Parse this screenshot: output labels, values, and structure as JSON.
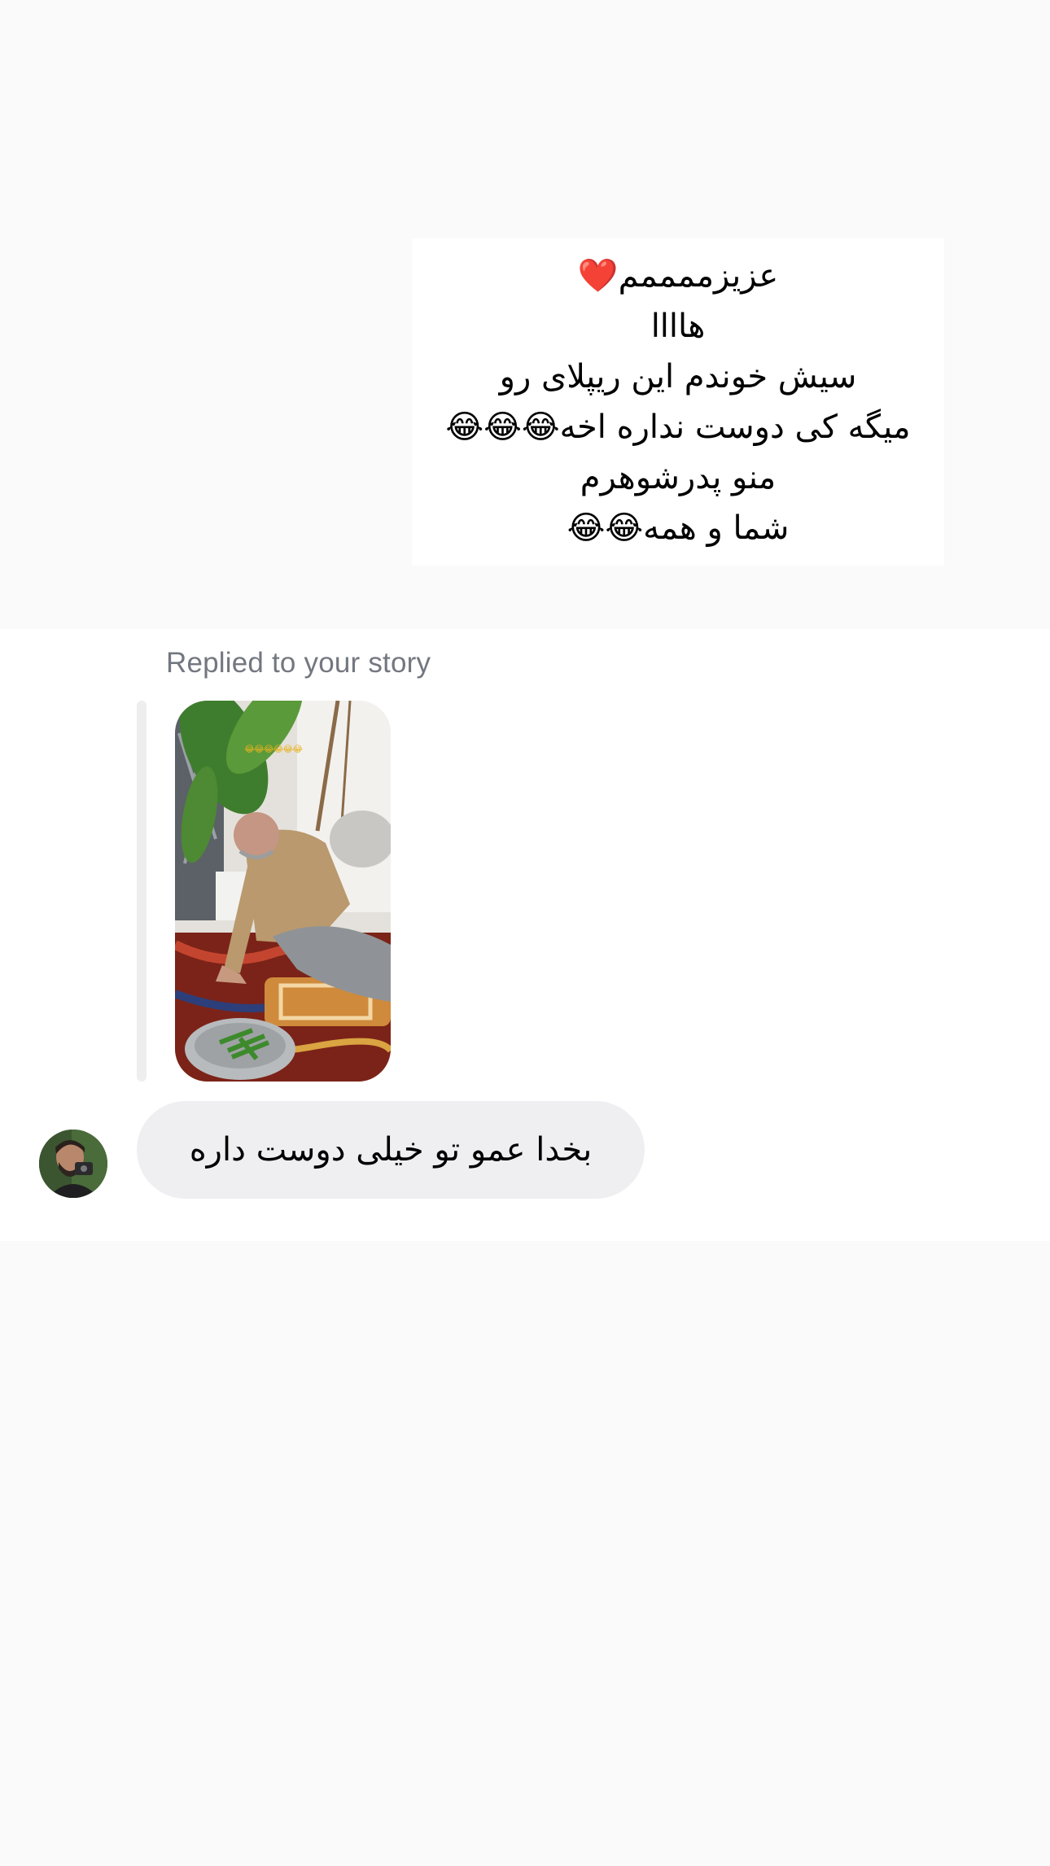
{
  "shared_post": {
    "caption_lines": [
      "عزیزممممم❤️",
      "هاااا",
      "سیش خوندم این ریپلای رو",
      "میگه کی دوست نداره اخه😂😂😂",
      "منو پدرشوهرم",
      "شما و همه😂😂"
    ]
  },
  "reply": {
    "label": "Replied to your story",
    "story_thumbnail": "story-photo-man-seated-on-rug",
    "story_overlay_text": "😂😂😂😂😂😂"
  },
  "message": {
    "sender_avatar": "avatar-photo",
    "text": "بخدا عمو تو خیلی دوست داره"
  },
  "colors": {
    "page_background": "#fafafa",
    "bubble_background": "#efeff1",
    "label_gray": "#737780",
    "quote_bar": "#eeeeee"
  }
}
